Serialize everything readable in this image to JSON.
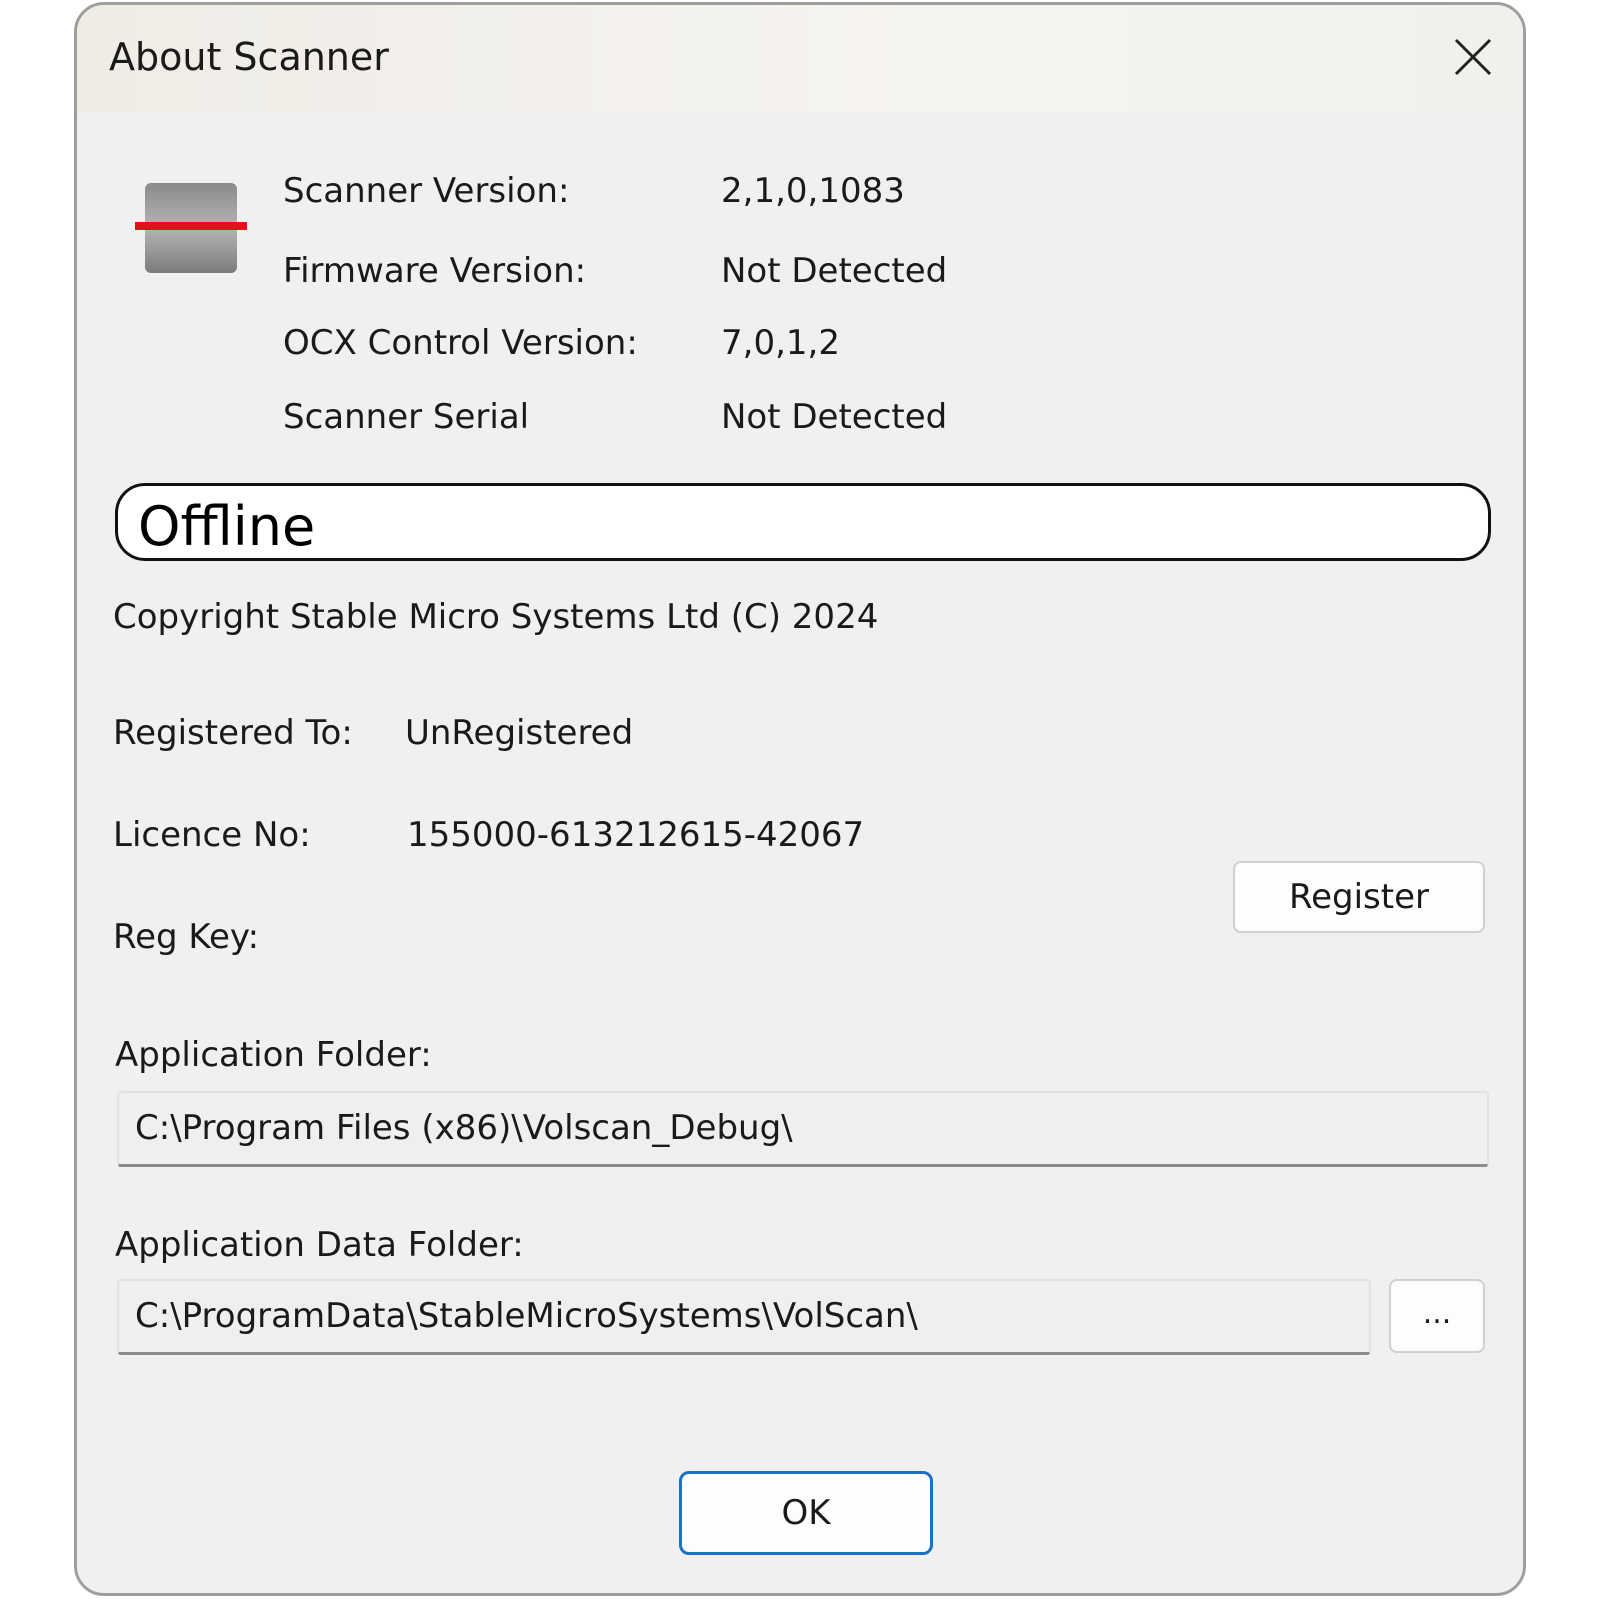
{
  "window": {
    "title": "About Scanner"
  },
  "info": {
    "scanner_version_label": "Scanner Version:",
    "scanner_version_value": "2,1,0,1083",
    "firmware_version_label": "Firmware Version:",
    "firmware_version_value": "Not Detected",
    "ocx_version_label": "OCX Control Version:",
    "ocx_version_value": "7,0,1,2",
    "serial_label": "Scanner Serial",
    "serial_value": "Not Detected"
  },
  "status": {
    "text": "Offline"
  },
  "copyright": "Copyright Stable Micro Systems Ltd (C) 2024",
  "registration": {
    "registered_to_label": "Registered To:",
    "registered_to_value": "UnRegistered",
    "licence_label": "Licence No:",
    "licence_value": "155000-613212615-42067",
    "reg_key_label": "Reg Key:",
    "register_button": "Register"
  },
  "folders": {
    "app_folder_label": "Application Folder:",
    "app_folder_value": "C:\\Program Files (x86)\\Volscan_Debug\\",
    "app_data_folder_label": "Application Data Folder:",
    "app_data_folder_value": "C:\\ProgramData\\StableMicroSystems\\VolScan\\",
    "browse_button": "..."
  },
  "buttons": {
    "ok": "OK"
  },
  "icons": {
    "app_icon": "scanner-icon",
    "close": "close-icon"
  },
  "colors": {
    "scan_line": "#e0121b",
    "ok_border": "#1f6fc5"
  }
}
